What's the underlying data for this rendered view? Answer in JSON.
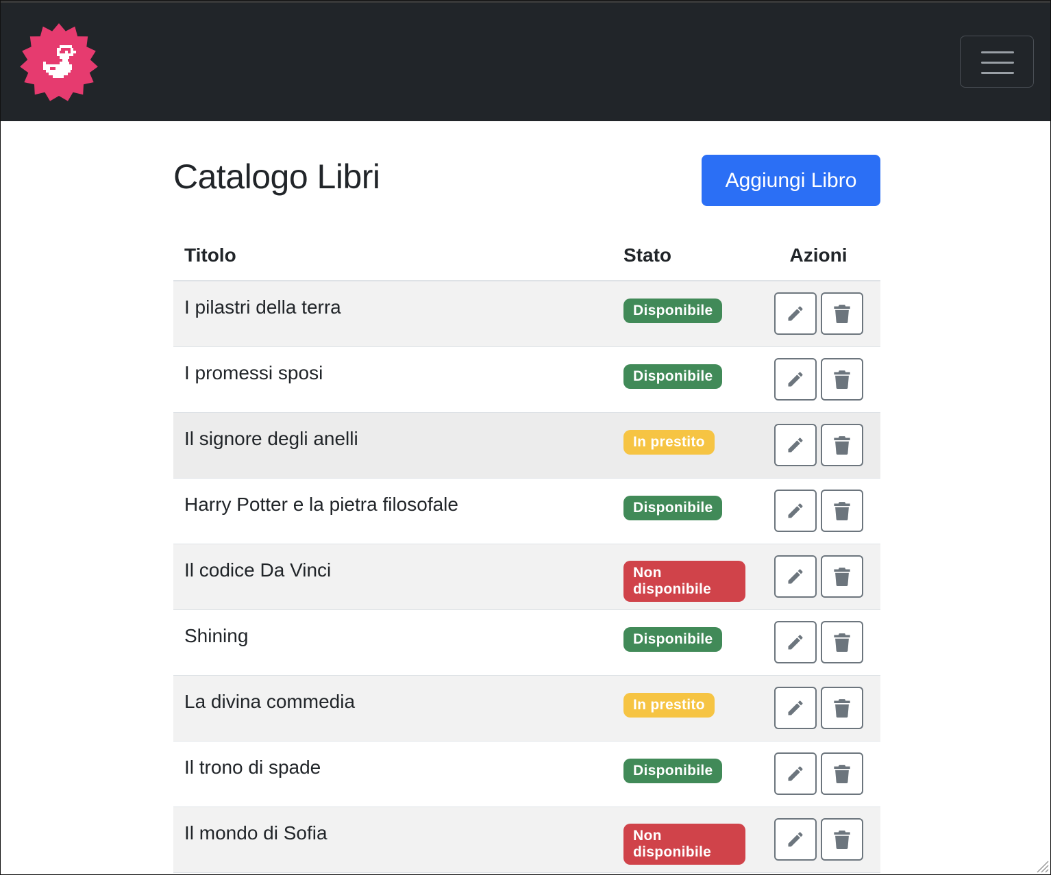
{
  "header": {
    "logo_icon": "duck-star-logo-icon",
    "menu_icon": "hamburger-menu-icon"
  },
  "main": {
    "title": "Catalogo Libri",
    "add_button_label": "Aggiungi Libro"
  },
  "table": {
    "columns": [
      "Titolo",
      "Stato",
      "Azioni"
    ],
    "rows": [
      {
        "title": "I pilastri della terra",
        "status": "Disponibile",
        "status_color": "#418a58"
      },
      {
        "title": "I promessi sposi",
        "status": "Disponibile",
        "status_color": "#418a58"
      },
      {
        "title": "Il signore degli anelli",
        "status": "In prestito",
        "status_color": "#f6c443"
      },
      {
        "title": "Harry Potter e la pietra filosofale",
        "status": "Disponibile",
        "status_color": "#418a58"
      },
      {
        "title": "Il codice Da Vinci",
        "status": "Non disponibile",
        "status_color": "#d0434a"
      },
      {
        "title": "Shining",
        "status": "Disponibile",
        "status_color": "#418a58"
      },
      {
        "title": "La divina commedia",
        "status": "In prestito",
        "status_color": "#f6c443"
      },
      {
        "title": "Il trono di spade",
        "status": "Disponibile",
        "status_color": "#418a58"
      },
      {
        "title": "Il mondo di Sofia",
        "status": "Non disponibile",
        "status_color": "#d0434a"
      }
    ],
    "edit_icon": "pencil-icon",
    "delete_icon": "trash-icon"
  },
  "colors": {
    "navbar": "#212529",
    "primary": "#2b6ff5",
    "success": "#418a58",
    "warning": "#f6c443",
    "danger": "#d0434a",
    "logo": "#e63b6f"
  }
}
